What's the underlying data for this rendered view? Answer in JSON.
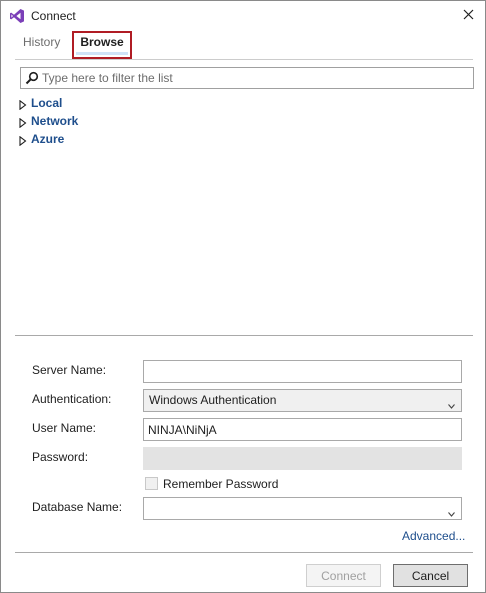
{
  "window": {
    "title": "Connect",
    "app_icon": "visual-studio-icon",
    "close_icon": "close-icon"
  },
  "tabs": [
    {
      "label": "History",
      "active": false
    },
    {
      "label": "Browse",
      "active": true
    }
  ],
  "filter": {
    "placeholder": "Type here to filter the list",
    "value": "",
    "icon": "search-icon"
  },
  "tree": [
    {
      "label": "Local",
      "expanded": false
    },
    {
      "label": "Network",
      "expanded": false
    },
    {
      "label": "Azure",
      "expanded": false
    }
  ],
  "form": {
    "server_name": {
      "label": "Server Name:",
      "value": ""
    },
    "authentication": {
      "label": "Authentication:",
      "value": "Windows Authentication"
    },
    "user_name": {
      "label": "User Name:",
      "value": "NINJA\\NiNjA"
    },
    "password": {
      "label": "Password:",
      "value": "",
      "enabled": false
    },
    "remember_password": {
      "label": "Remember Password",
      "checked": false,
      "enabled": false
    },
    "database_name": {
      "label": "Database Name:",
      "value": ""
    },
    "advanced_link": "Advanced..."
  },
  "buttons": {
    "connect": "Connect",
    "connect_enabled": false,
    "cancel": "Cancel"
  },
  "colors": {
    "accent_border": "#b01c24",
    "link": "#1e4e8c",
    "tab_highlight": "#cfe3f7"
  }
}
